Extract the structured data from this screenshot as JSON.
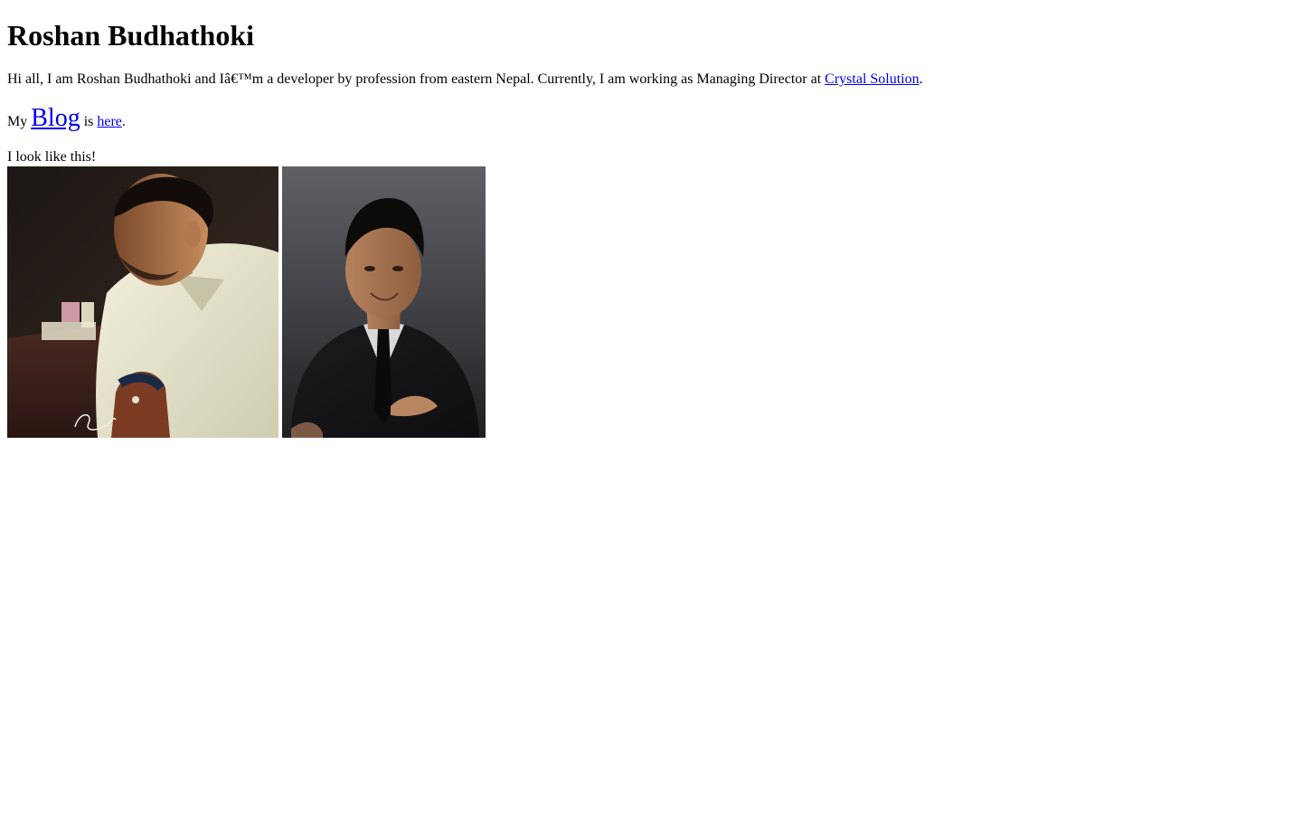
{
  "page": {
    "title": "Roshan Budhathoki"
  },
  "intro": {
    "text_before_link": "Hi all, I am Roshan Budhathoki and Iâ€™m a developer by profession from eastern Nepal. Currently, I am working as Managing Director at ",
    "link_label": "Crystal Solution",
    "text_after_link": "."
  },
  "blog": {
    "prefix": "My ",
    "blog_word": "Blog",
    "middle": " is ",
    "link_label": "here",
    "suffix": "."
  },
  "gallery": {
    "caption": "I look like this!"
  },
  "colors": {
    "link": "#0000ee",
    "text": "#000000",
    "background": "#ffffff"
  }
}
